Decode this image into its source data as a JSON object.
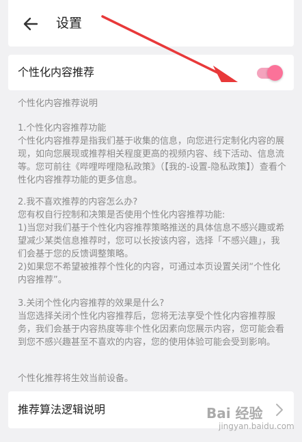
{
  "header": {
    "title": "设置"
  },
  "personalized": {
    "label": "个性化内容推荐",
    "enabled": true
  },
  "description": {
    "heading": "个性化内容推荐说明",
    "section1_title": "1.个性化内容推荐功能",
    "section1_body": "个性化内容推荐是指我们基于收集的信息，向您进行定制化内容的展现，如向您展现或推荐相关程度更高的视频内容、线下活动、信息流等。您可前往《哔哩哔哩隐私政策》（【我的-设置-隐私政策】）查看个性化内容推荐功能的更多信息。",
    "section2_title": "2.我不喜欢推荐的内容怎么办?",
    "section2_intro": "您有权自行控制和决策是否使用个性化内容推荐功能:",
    "section2_item1": "1)当您对我们基于个性化内容推荐策略推送的具体信息不感兴趣或希望减少某类信息推荐时，您可以长按该内容，选择「不感兴趣」，我们会基于您的反馈调整策略。",
    "section2_item2": "2)如果您不希望被推荐个性化的内容，可通过本页设置关闭“个性化内容推荐”。",
    "section3_title": "3.关闭个性化内容推荐的效果是什么?",
    "section3_body": "当您选择关闭个性化内容推荐后，您将无法享受个性化内容推荐服务，我们会基于内容热度等非个性化因素向您展示内容，您可能会看到您不感兴趣甚至不喜欢的内容，您的使用体验可能会受到影响。",
    "footer_note": "个性化推荐将生效当前设备。"
  },
  "algorithm": {
    "label": "推荐算法逻辑说明"
  },
  "watermark": {
    "text": "Bai 经验",
    "sub": "jingyan.baidu.com"
  },
  "colors": {
    "accent": "#fb7299",
    "annotation_arrow": "#e8393a"
  },
  "icons": {
    "back": "arrow-left-icon",
    "chevron": "chevron-right-icon"
  }
}
